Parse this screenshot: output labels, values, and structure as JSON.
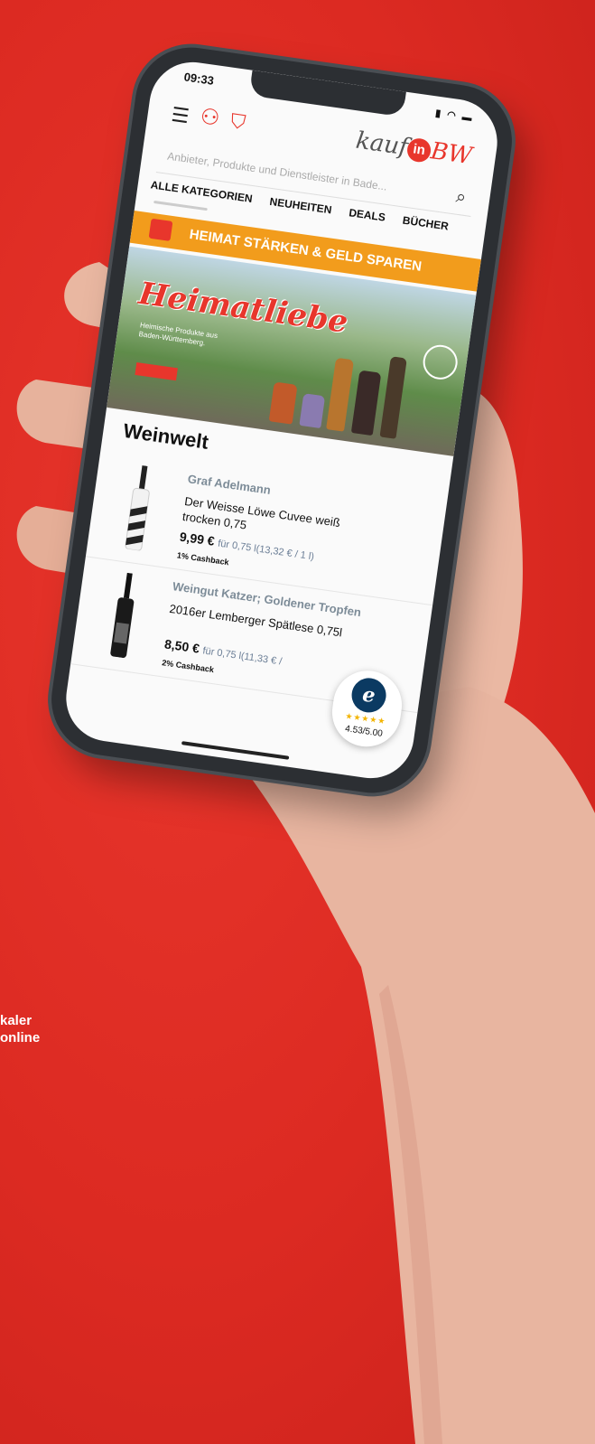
{
  "side_text": [
    "kaler",
    "online"
  ],
  "status": {
    "time": "09:33",
    "icons": "▮ ◠ ▬"
  },
  "header": {
    "logo_pre": "kauf",
    "logo_in": "in",
    "logo_bw": "BW"
  },
  "search": {
    "placeholder": "Anbieter, Produkte und Dienstleister in Bade..."
  },
  "categories": [
    "ALLE KATEGORIEN",
    "NEUHEITEN",
    "DEALS",
    "BÜCHER"
  ],
  "promo": {
    "label": "HEIMAT STÄRKEN & GELD SPAREN"
  },
  "hero": {
    "title": "Heimatliebe",
    "subtitle": "Heimische Produkte aus Baden-Württemberg."
  },
  "section_title": "Weinwelt",
  "products": [
    {
      "brand": "Graf Adelmann",
      "name": "Der Weisse Löwe Cuvee weiß trocken 0,75",
      "price": "9,99 €",
      "unit": "für 0,75 l(13,32 € / 1 l)",
      "cashback": "1% Cashback"
    },
    {
      "brand": "Weingut Katzer; Goldener Tropfen",
      "name": "2016er Lemberger Spätlese 0,75l",
      "price": "8,50 €",
      "unit": "für 0,75 l(11,33 € /",
      "cashback": "2% Cashback"
    }
  ],
  "trust": {
    "score": "4.53",
    "max": "/5.00",
    "stars": "★★★★★"
  },
  "colors": {
    "background": "#dc2a22",
    "accent": "#e8362c",
    "promo": "#f29c1c"
  }
}
